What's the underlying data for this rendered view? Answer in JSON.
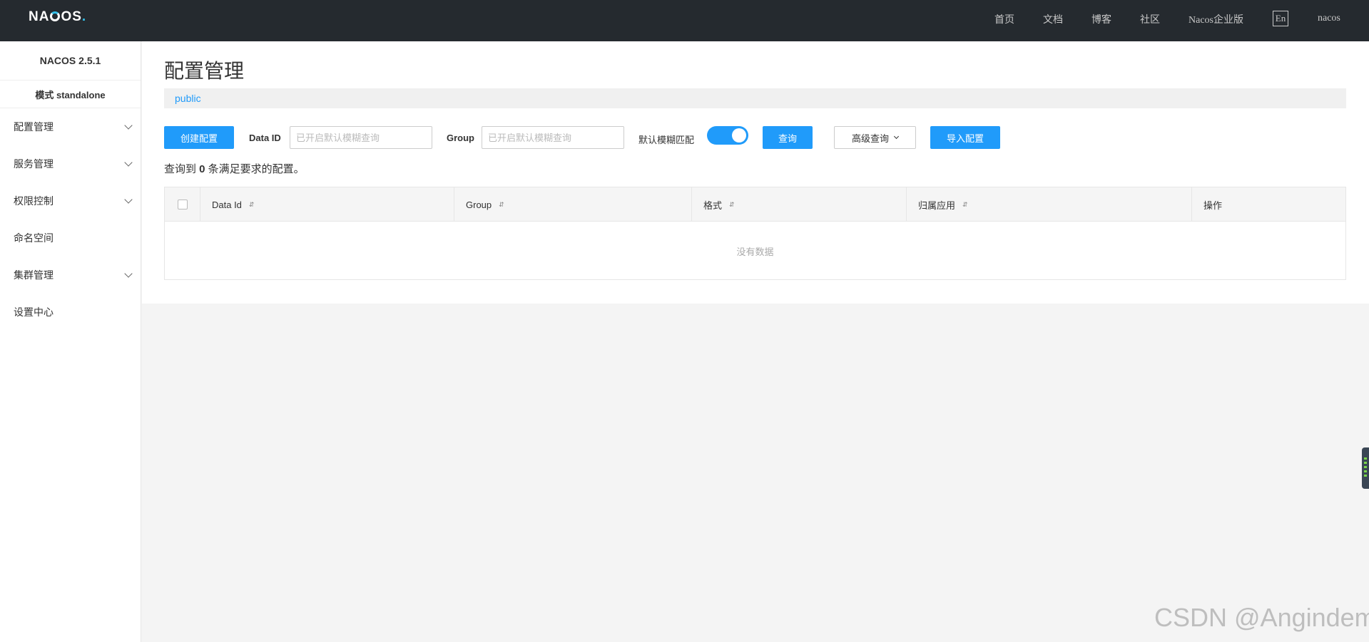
{
  "app": {
    "logo": {
      "pre": "NA",
      "post": "OS",
      "dot": "."
    },
    "nav": [
      "首页",
      "文档",
      "博客",
      "社区",
      "Nacos企业版"
    ],
    "lang": "En",
    "user": "nacos"
  },
  "sidebar": {
    "version": "NACOS 2.5.1",
    "mode": "模式 standalone",
    "items": [
      {
        "label": "配置管理",
        "expandable": true
      },
      {
        "label": "服务管理",
        "expandable": true
      },
      {
        "label": "权限控制",
        "expandable": true
      },
      {
        "label": "命名空间",
        "expandable": false
      },
      {
        "label": "集群管理",
        "expandable": true
      },
      {
        "label": "设置中心",
        "expandable": false
      }
    ]
  },
  "main": {
    "title": "配置管理",
    "namespace": "public",
    "toolbar": {
      "create_label": "创建配置",
      "dataid_label": "Data ID",
      "dataid_placeholder": "已开启默认模糊查询",
      "group_label": "Group",
      "group_placeholder": "已开启默认模糊查询",
      "fuzzy_label": "默认模糊匹配",
      "fuzzy_on": true,
      "search_label": "查询",
      "advanced_label": "高级查询",
      "import_label": "导入配置"
    },
    "result": {
      "pre": "查询到 ",
      "count": "0",
      "post": " 条满足要求的配置。"
    },
    "table": {
      "columns": [
        "Data Id",
        "Group",
        "格式",
        "归属应用",
        "操作"
      ],
      "empty_text": "没有数据"
    }
  },
  "watermark": "CSDN @Angindem",
  "colors": {
    "primary": "#209bfa",
    "topbar": "#252a2f"
  }
}
